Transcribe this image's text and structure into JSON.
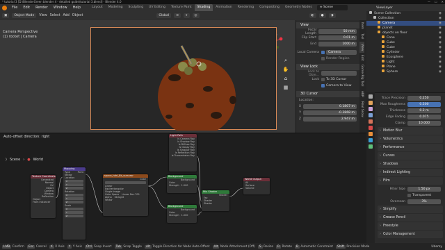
{
  "window_title": "* tutorial 3 [D:\\BlenderGreen blender 4 - detailed guide\\tutorial 3.blend] - Blender 4.0",
  "window_controls": [
    "—",
    "☐",
    "✕"
  ],
  "menu": [
    "File",
    "Edit",
    "Render",
    "Window",
    "Help"
  ],
  "workspaces": [
    "Layout",
    "Modeling",
    "Sculpting",
    "UV Editing",
    "Texture Paint",
    "Shading",
    "Animation",
    "Rendering",
    "Compositing",
    "Geometry Nodes",
    "Scripting"
  ],
  "active_workspace": "Shading",
  "scene_name": "Scene",
  "view_layer": "ViewLayer",
  "viewport": {
    "mode": "Object Mode",
    "menus": [
      "View",
      "Select",
      "Add",
      "Object"
    ],
    "orientation": "Global",
    "info_line1": "Camera Perspective",
    "info_line2": "(1) rocket | Camera",
    "colors": {
      "planet": "#7a3312",
      "background": "#272727",
      "frame": "#d88a57"
    }
  },
  "npanel": {
    "tabs": [
      "Item",
      "Tool",
      "View",
      "Edit",
      "Game Rig Tool",
      "ABP",
      "Real Snow"
    ],
    "view_section": "View",
    "focal_label": "Focal Length",
    "focal_value": "50 mm",
    "clip_start_label": "Clip Start",
    "clip_start_value": "0.01 m",
    "clip_end_label": "End",
    "clip_end_value": "1000 m",
    "local_camera_label": "Local Camera",
    "local_camera_value": "Camera",
    "render_region": "Render Region",
    "view_lock_section": "View Lock",
    "lock_object_label": "Lock to Obje...",
    "lock_label": "Lock",
    "to_3d_cursor": "To 3D Cursor",
    "camera_to_view": "Camera to View",
    "cursor_section": "3D Cursor",
    "location_label": "Location:",
    "x_label": "X",
    "x_value": "0.1807 m",
    "y_label": "Y",
    "y_value": "-0.3868 m",
    "z_label": "Z",
    "z_value": "2.947 m"
  },
  "outliner": {
    "rows": [
      {
        "label": "Scene Collection",
        "indent": 0,
        "selected": false
      },
      {
        "label": "Collection",
        "indent": 1,
        "selected": false
      },
      {
        "label": "Camera",
        "indent": 2,
        "selected": true
      },
      {
        "label": "planet",
        "indent": 2,
        "selected": false
      },
      {
        "label": "objects on floor",
        "indent": 2,
        "selected": false
      },
      {
        "label": "Cone",
        "indent": 3,
        "selected": false
      },
      {
        "label": "Cube",
        "indent": 3,
        "selected": false
      },
      {
        "label": "Cube",
        "indent": 3,
        "selected": false
      },
      {
        "label": "Cylinder",
        "indent": 3,
        "selected": false
      },
      {
        "label": "Ecosphere",
        "indent": 3,
        "selected": false
      },
      {
        "label": "Light",
        "indent": 3,
        "selected": false
      },
      {
        "label": "Plane",
        "indent": 3,
        "selected": false
      },
      {
        "label": "Sphere",
        "indent": 3,
        "selected": false
      }
    ]
  },
  "properties": {
    "rows": [
      {
        "label": "Trace Precision",
        "value": "0.250"
      },
      {
        "label": "Max Roughness",
        "value": "0.500"
      },
      {
        "label": "Thickness",
        "value": "0.2 m"
      },
      {
        "label": "Edge Fading",
        "value": "0.075"
      },
      {
        "label": "Clamp",
        "value": "10.000"
      }
    ],
    "sections_a": [
      "Motion Blur",
      "Volumetrics",
      "Performance",
      "Curves",
      "Shadows",
      "Indirect Lighting",
      "Film"
    ],
    "filter_size_label": "Filter Size",
    "filter_size_value": "1.50 px",
    "transparent_label": "Transparent",
    "overscan_label": "Overscan",
    "overscan_value": "3%",
    "sections_b": [
      "Simplify",
      "Grease Pencil",
      "Freestyle",
      "Color Management"
    ]
  },
  "node_editor": {
    "header_text": "Auto-offset direction: right",
    "breadcrumb_scene": "Scene",
    "breadcrumb_world": "World",
    "nodes": {
      "texcoord": {
        "title": "Texture Coordinate",
        "outputs": [
          "Generated",
          "Normal",
          "UV",
          "Object",
          "Camera",
          "Window",
          "Reflection"
        ],
        "object_label": "Object",
        "from_instancer": "From Instancer"
      },
      "mapping": {
        "title": "Mapping",
        "type_label": "Type",
        "type_value": "Point",
        "inputs": [
          "Vector",
          "Location",
          "X",
          "Y",
          "Z",
          "Rotation",
          "X",
          "Y",
          "Z",
          "Scale",
          "X",
          "Y",
          "Z"
        ]
      },
      "envtex": {
        "title": "space_hdri_8k_sum.exr",
        "rows": [
          "Linear",
          "Equirectangular",
          "Single Image",
          "Color Space",
          "Alpha",
          "Vector"
        ],
        "color_space_value": "Linear Rec.709",
        "alpha_value": "Straight"
      },
      "lightpath": {
        "title": "Light Path",
        "outputs": [
          "Is Camera Ray",
          "Is Shadow Ray",
          "Is Diffuse Ray",
          "Is Glossy Ray",
          "Is Singular Ray",
          "Is Reflection Ray",
          "Is Transmission Ray"
        ]
      },
      "bg1": {
        "title": "Background",
        "rows": [
          "Background",
          "Color",
          "Strength"
        ],
        "strength_value": "1.000"
      },
      "bg2": {
        "title": "Background",
        "rows": [
          "Background",
          "Color",
          "Strength"
        ],
        "strength_value": "1.000"
      },
      "mix": {
        "title": "Mix Shader",
        "rows": [
          "Shader",
          "Fac",
          "Shader",
          "Shader"
        ]
      },
      "output": {
        "title": "World Output",
        "rows": [
          "All",
          "Surface",
          "Volume"
        ]
      }
    }
  },
  "status_bar": {
    "items": [
      {
        "key": "LMB",
        "label": "Confirm"
      },
      {
        "key": "Esc",
        "label": "Cancel"
      },
      {
        "key": "X",
        "label": "X Axis"
      },
      {
        "key": "Y",
        "label": "Y Axis"
      },
      {
        "key": "Ctrl",
        "label": "Snap Invert"
      },
      {
        "key": "Tab",
        "label": "Snap Toggle"
      },
      {
        "key": "Alt",
        "label": "Toggle Direction for Node Auto-Offset"
      },
      {
        "key": "Alt",
        "label": "Node Attachment (Off)"
      },
      {
        "key": "S",
        "label": "Resize"
      },
      {
        "key": "R",
        "label": "Rotate"
      },
      {
        "key": "B",
        "label": "Automatic Constraint"
      },
      {
        "key": "Shift",
        "label": "Precision Mode"
      }
    ],
    "watermark": "Udemy"
  }
}
